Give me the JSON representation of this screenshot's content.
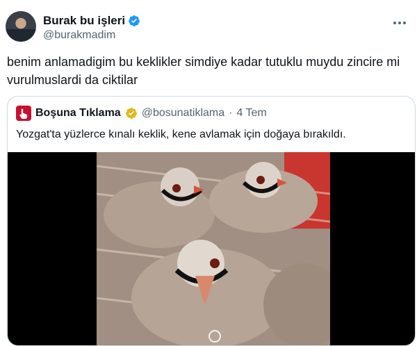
{
  "author": {
    "display_name": "Burak bu işleri",
    "handle": "@burakmadim",
    "verified_icon": "verified-badge-icon",
    "badge_color": "#1d9bf0"
  },
  "tweet": {
    "text": "benim anlamadigim bu keklikler simdiye kadar tutuklu muydu zincire mi vurulmuslardi da ciktilar"
  },
  "quote": {
    "display_name": "Boşuna Tıklama",
    "handle": "@bosunatiklama",
    "separator": "·",
    "date": "4 Tem",
    "verified_icon": "gold-verified-badge-icon",
    "badge_color": "#e2b719",
    "text": "Yozgat'ta yüzlerce kınalı keklik, kene avlamak için doğaya bırakıldı.",
    "media_alt": "Partridges in a crate"
  }
}
